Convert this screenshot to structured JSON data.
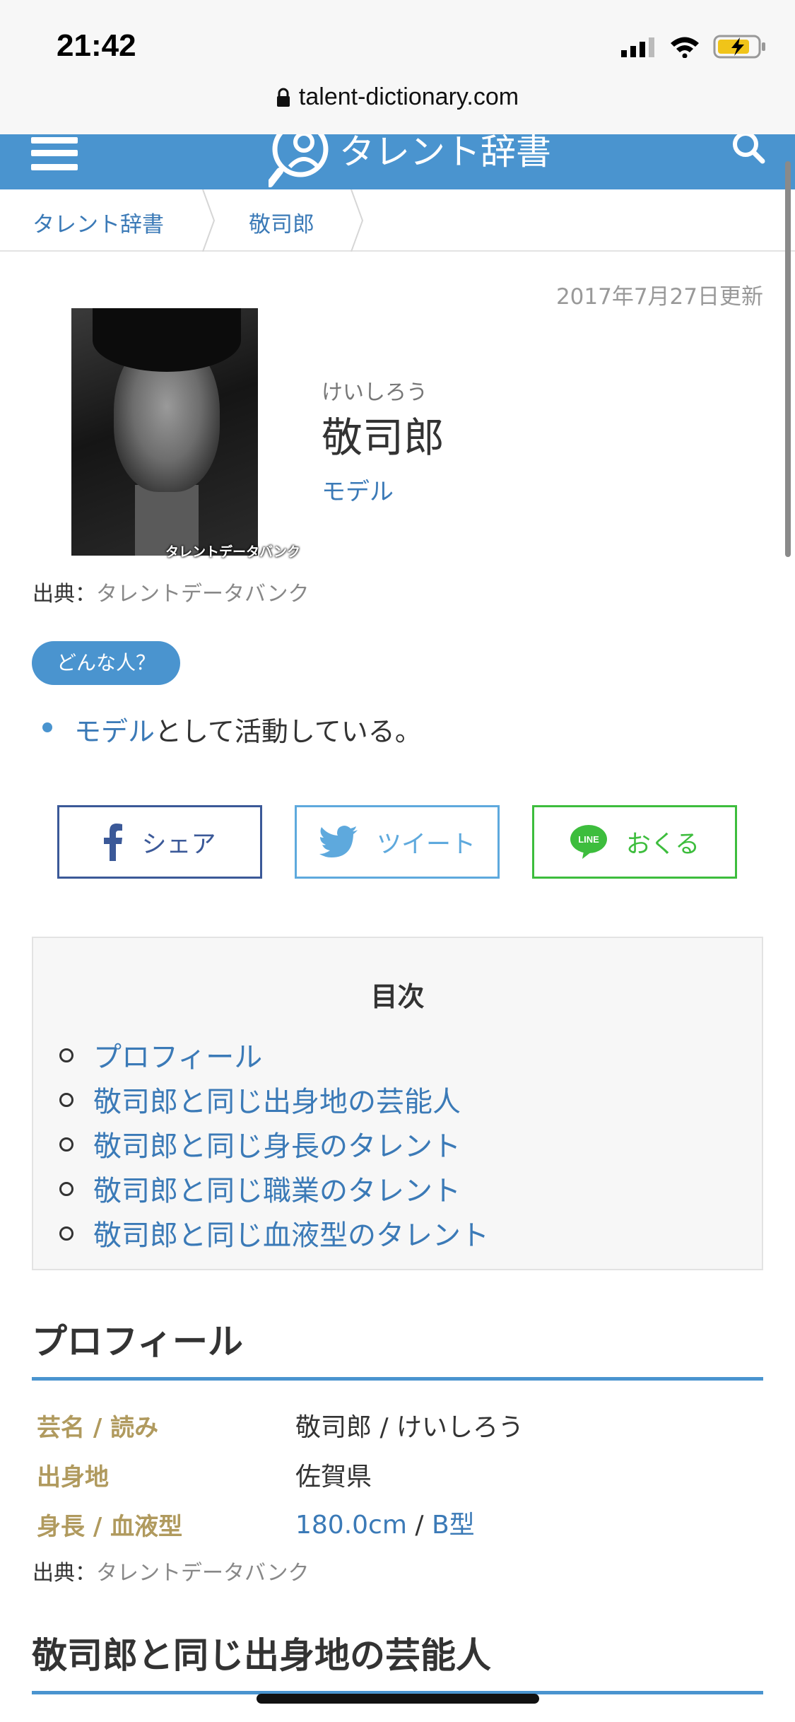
{
  "status_bar": {
    "time": "21:42",
    "url": "talent-dictionary.com"
  },
  "header": {
    "logo_text": "タレント辞書"
  },
  "breadcrumb": {
    "items": [
      "タレント辞書",
      "敬司郎"
    ]
  },
  "article": {
    "updated": "2017年7月27日更新",
    "photo_watermark": "タレントデータバンク",
    "reading": "けいしろう",
    "name": "敬司郎",
    "occupation": "モデル",
    "source_label": "出典：",
    "source_name": "タレントデータバンク",
    "badge": "どんな人？",
    "summary_link": "モデル",
    "summary_rest": "として活動している。"
  },
  "share": {
    "facebook": "シェア",
    "twitter": "ツイート",
    "line": "おくる",
    "line_logo": "LINE"
  },
  "toc": {
    "title": "目次",
    "items": [
      "プロフィール",
      "敬司郎と同じ出身地の芸能人",
      "敬司郎と同じ身長のタレント",
      "敬司郎と同じ職業のタレント",
      "敬司郎と同じ血液型のタレント"
    ]
  },
  "profile": {
    "heading": "プロフィール",
    "rows": [
      {
        "label": "芸名 / 読み",
        "value": "敬司郎 / けいしろう"
      },
      {
        "label": "出身地",
        "value": "佐賀県"
      },
      {
        "label": "身長 / 血液型",
        "height": "180.0cm",
        "sep": " / ",
        "blood": "B型"
      }
    ],
    "source_label": "出典：",
    "source_name": "タレントデータバンク"
  },
  "next_section": {
    "heading": "敬司郎と同じ出身地の芸能人"
  },
  "colors": {
    "accent": "#4a94cf",
    "link": "#3b7ab7",
    "label": "#b09a5e",
    "facebook": "#3b5998",
    "twitter": "#5ea9dd",
    "line": "#3dbd3d"
  }
}
